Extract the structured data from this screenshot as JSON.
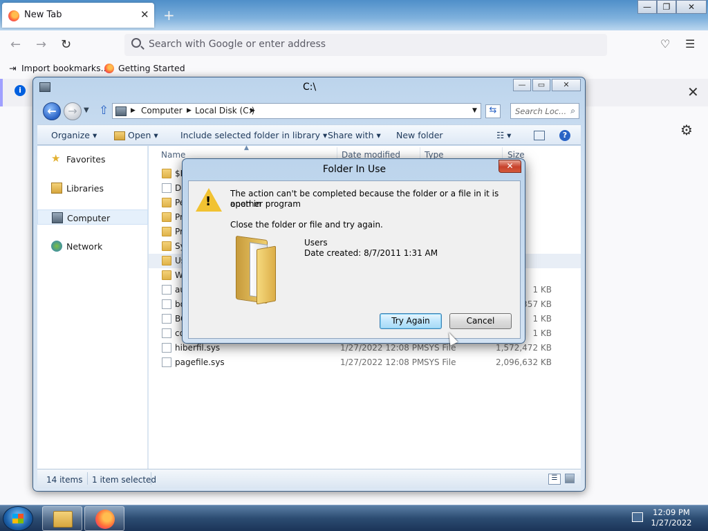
{
  "browser": {
    "tab_title": "New Tab",
    "tab_close": "✕",
    "new_tab": "+",
    "url_placeholder": "Search with Google or enter address",
    "bookmarks": [
      "Import bookmarks...",
      "Getting Started"
    ],
    "window_controls": [
      "—",
      "❐",
      "✕"
    ]
  },
  "explorer": {
    "title": "C:\\",
    "address_crumbs": [
      "Computer",
      "Local Disk (C:)"
    ],
    "search_placeholder": "Search Loc...",
    "toolbar": {
      "organize": "Organize ▾",
      "open": "Open ▾",
      "include": "Include selected folder in library ▾",
      "share": "Share with ▾",
      "new_folder": "New folder"
    },
    "nav": [
      "Favorites",
      "Libraries",
      "Computer",
      "Network"
    ],
    "columns": [
      "Name",
      "Date modified",
      "Type",
      "Size"
    ],
    "rows": [
      {
        "name": "$R",
        "date": "",
        "type": "",
        "size": ""
      },
      {
        "name": "Do",
        "date": "",
        "type": "",
        "size": ""
      },
      {
        "name": "Pe",
        "date": "",
        "type": "",
        "size": ""
      },
      {
        "name": "Pr",
        "date": "",
        "type": "",
        "size": ""
      },
      {
        "name": "Pr",
        "date": "",
        "type": "",
        "size": ""
      },
      {
        "name": "Sy",
        "date": "",
        "type": "",
        "size": ""
      },
      {
        "name": "Us",
        "date": "",
        "type": "",
        "size": ""
      },
      {
        "name": "Wi",
        "date": "",
        "type": "",
        "size": ""
      },
      {
        "name": "au",
        "date": "",
        "type": "",
        "size": "1 KB"
      },
      {
        "name": "bo",
        "date": "",
        "type": "",
        "size": "357 KB"
      },
      {
        "name": "BO",
        "date": "",
        "type": "",
        "size": "1 KB"
      },
      {
        "name": "co",
        "date": "",
        "type": "",
        "size": "1 KB"
      },
      {
        "name": "hiberfil.sys",
        "date": "1/27/2022 12:08 PM",
        "type": "SYS File",
        "size": "1,572,472 KB"
      },
      {
        "name": "pagefile.sys",
        "date": "1/27/2022 12:08 PM",
        "type": "SYS File",
        "size": "2,096,632 KB"
      }
    ],
    "status": {
      "count": "14 items",
      "selected": "1 item selected"
    }
  },
  "dialog": {
    "title": "Folder In Use",
    "close": "✕",
    "message_line1": "The action can't be completed because the folder or a file in it is open in",
    "message_line2": "another program",
    "instruction": "Close the folder or file and try again.",
    "item_name": "Users",
    "item_date": "Date created: 8/7/2011 1:31 AM",
    "try_again": "Try Again",
    "cancel": "Cancel"
  },
  "taskbar": {
    "time": "12:09 PM",
    "date": "1/27/2022"
  }
}
